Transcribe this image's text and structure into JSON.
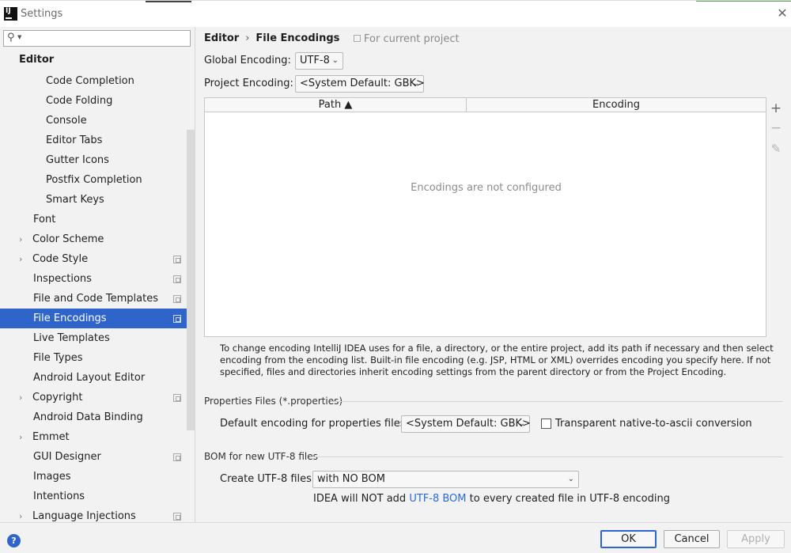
{
  "window": {
    "title": "Settings",
    "app_icon": "intellij-icon",
    "close_icon": "close-icon"
  },
  "sidebar": {
    "search": {
      "value": "",
      "placeholder": ""
    },
    "heading": "Editor",
    "items": [
      {
        "label": "Code Completion",
        "level": "sub"
      },
      {
        "label": "Code Folding",
        "level": "sub"
      },
      {
        "label": "Console",
        "level": "sub"
      },
      {
        "label": "Editor Tabs",
        "level": "sub"
      },
      {
        "label": "Gutter Icons",
        "level": "sub"
      },
      {
        "label": "Postfix Completion",
        "level": "sub"
      },
      {
        "label": "Smart Keys",
        "level": "sub"
      },
      {
        "label": "Font",
        "level": "top"
      },
      {
        "label": "Color Scheme",
        "level": "top",
        "expandable": true
      },
      {
        "label": "Code Style",
        "level": "top",
        "expandable": true,
        "project": true
      },
      {
        "label": "Inspections",
        "level": "top",
        "project": true
      },
      {
        "label": "File and Code Templates",
        "level": "top",
        "project": true
      },
      {
        "label": "File Encodings",
        "level": "top",
        "project": true,
        "selected": true
      },
      {
        "label": "Live Templates",
        "level": "top"
      },
      {
        "label": "File Types",
        "level": "top"
      },
      {
        "label": "Android Layout Editor",
        "level": "top"
      },
      {
        "label": "Copyright",
        "level": "top",
        "expandable": true,
        "project": true
      },
      {
        "label": "Android Data Binding",
        "level": "top"
      },
      {
        "label": "Emmet",
        "level": "top",
        "expandable": true
      },
      {
        "label": "GUI Designer",
        "level": "top",
        "project": true
      },
      {
        "label": "Images",
        "level": "top"
      },
      {
        "label": "Intentions",
        "level": "top"
      },
      {
        "label": "Language Injections",
        "level": "top",
        "expandable": true,
        "project": true
      }
    ]
  },
  "breadcrumb": {
    "parent": "Editor",
    "separator": "›",
    "current": "File Encodings",
    "scope": "For current project"
  },
  "global_encoding": {
    "label": "Global Encoding:",
    "value": "UTF-8"
  },
  "project_encoding": {
    "label": "Project Encoding:",
    "value": "<System Default: GBK>"
  },
  "table": {
    "columns": [
      "Path ▲",
      "Encoding"
    ],
    "rows": [],
    "empty_text": "Encodings are not configured",
    "toolbar": [
      "+",
      "−",
      "✎"
    ]
  },
  "info_text": "To change encoding IntelliJ IDEA uses for a file, a directory, or the entire project, add its path if necessary and then select encoding from the encoding list. Built-in file encoding (e.g. JSP, HTML or XML) overrides encoding you specify here. If not specified, files and directories inherit encoding settings from the parent directory or from the Project Encoding.",
  "properties": {
    "section_title": "Properties Files (*.properties)",
    "default_label": "Default encoding for properties files:",
    "default_value": "<System Default: GBK>",
    "transparent_label": "Transparent native-to-ascii conversion",
    "transparent_checked": false
  },
  "bom": {
    "section_title": "BOM for new UTF-8 files",
    "create_label": "Create UTF-8 files:",
    "create_value": "with NO BOM",
    "note_prefix": "IDEA will NOT add ",
    "note_link": "UTF-8 BOM",
    "note_suffix": " to every created file in UTF-8 encoding"
  },
  "footer": {
    "help": "?",
    "ok": "OK",
    "cancel": "Cancel",
    "apply": "Apply"
  },
  "colors": {
    "selection": "#2f65ca",
    "link": "#2b6bd6",
    "background": "#f2f2f2"
  }
}
